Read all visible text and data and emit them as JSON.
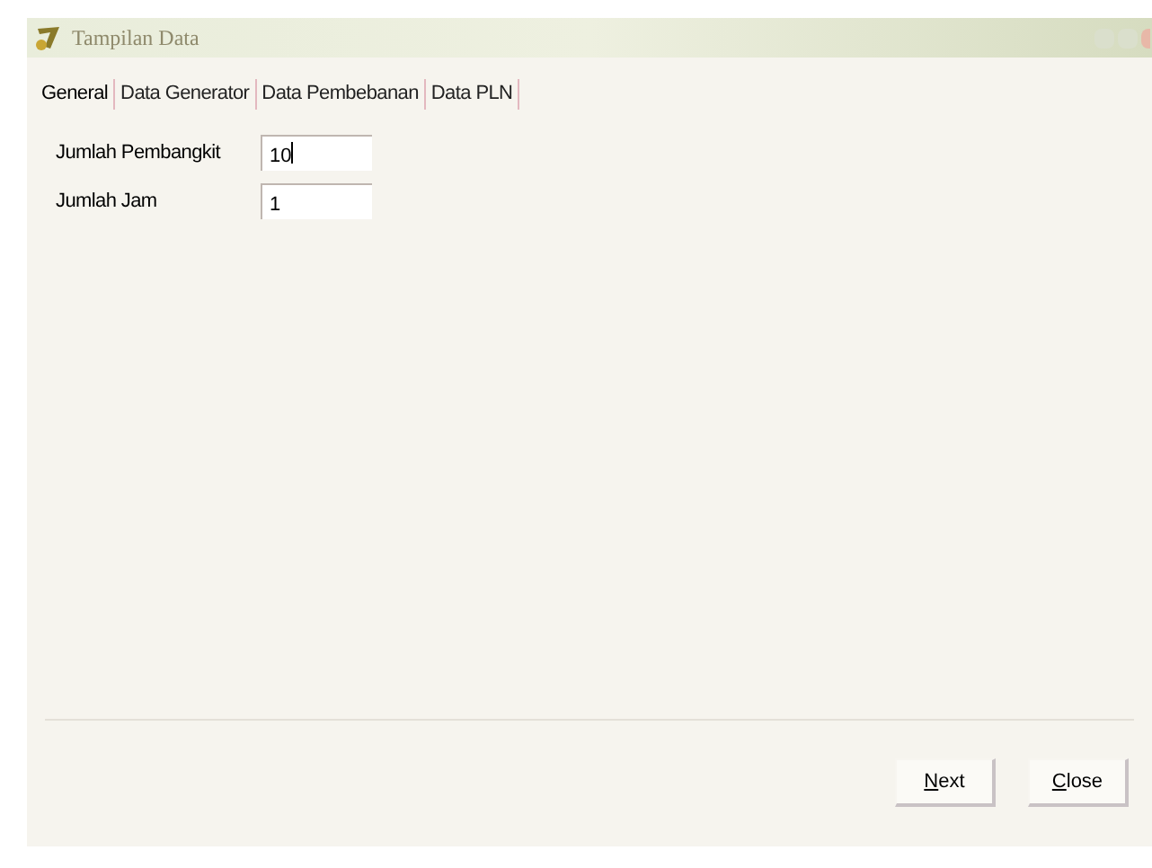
{
  "window": {
    "title": "Tampilan Data"
  },
  "tabs": [
    {
      "label": "General",
      "selected": true
    },
    {
      "label": "Data Generator",
      "selected": false
    },
    {
      "label": "Data Pembebanan",
      "selected": false
    },
    {
      "label": "Data PLN",
      "selected": false
    }
  ],
  "fields": [
    {
      "label": "Jumlah Pembangkit",
      "value": "10",
      "focused": true
    },
    {
      "label": "Jumlah Jam",
      "value": "1",
      "focused": false
    }
  ],
  "buttons": [
    {
      "label": "Next",
      "mnemonic_underlined": true
    },
    {
      "label": "Close",
      "mnemonic_underlined": true
    }
  ]
}
